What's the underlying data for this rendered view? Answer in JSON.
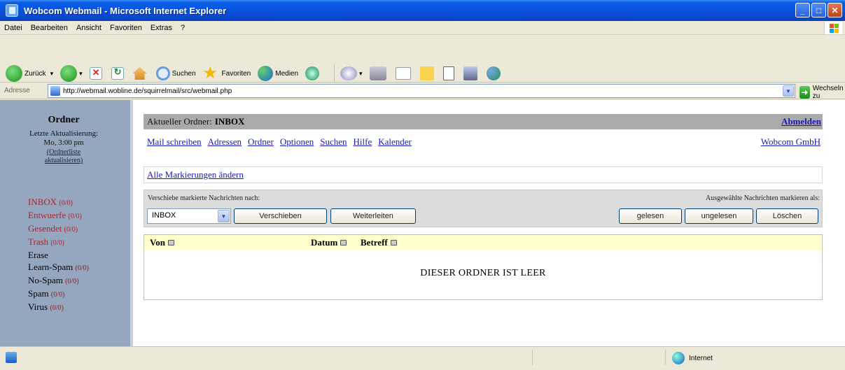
{
  "window": {
    "title": "Wobcom Webmail - Microsoft Internet Explorer"
  },
  "menu": [
    "Datei",
    "Bearbeiten",
    "Ansicht",
    "Favoriten",
    "Extras",
    "?"
  ],
  "toolbar": {
    "back_label": "Zurück",
    "search_label": "Suchen",
    "favorites_label": "Favoriten",
    "media_label": "Medien"
  },
  "address": {
    "label": "Adresse",
    "url": "http://webmail.wobline.de/squirrelmail/src/webmail.php",
    "go_label": "Wechseln zu"
  },
  "sidebar": {
    "title": "Ordner",
    "last_update_label": "Letzte Aktualisierung:",
    "last_update_time": "Mo, 3:00 pm",
    "refresh_link_line1": "(Ordnerliste",
    "refresh_link_line2": "aktualisieren)",
    "folders": [
      {
        "name": "INBOX",
        "count": "(0/0)"
      },
      {
        "name": "Entwuerfe",
        "count": "(0/0)"
      },
      {
        "name": "Gesendet",
        "count": "(0/0)"
      },
      {
        "name": "Trash",
        "count": "(0/0)"
      },
      {
        "name": "Erase",
        "count": ""
      },
      {
        "name": "Learn-Spam",
        "count": "(0/0)"
      },
      {
        "name": "No-Spam",
        "count": "(0/0)"
      },
      {
        "name": "Spam",
        "count": "(0/0)"
      },
      {
        "name": "Virus",
        "count": "(0/0)"
      }
    ]
  },
  "main": {
    "current_folder_label": "Aktueller Ordner:",
    "current_folder": "INBOX",
    "logout": "Abmelden",
    "nav": [
      "Mail schreiben",
      "Adressen",
      "Ordner",
      "Optionen",
      "Suchen",
      "Hilfe",
      "Kalender"
    ],
    "company": "Wobcom GmbH",
    "toggle_all": "Alle Markierungen ändern",
    "move_label": "Verschiebe markierte Nachrichten nach:",
    "mark_label": "Ausgewählte Nachrichten markieren als:",
    "move_select_value": "INBOX",
    "move_button": "Verschieben",
    "forward_button": "Weiterleiten",
    "read_button": "gelesen",
    "unread_button": "ungelesen",
    "delete_button": "Löschen",
    "columns": {
      "from": "Von",
      "date": "Datum",
      "subject": "Betreff"
    },
    "empty_message": "DIESER ORDNER IST LEER"
  },
  "status": {
    "zone": "Internet"
  }
}
